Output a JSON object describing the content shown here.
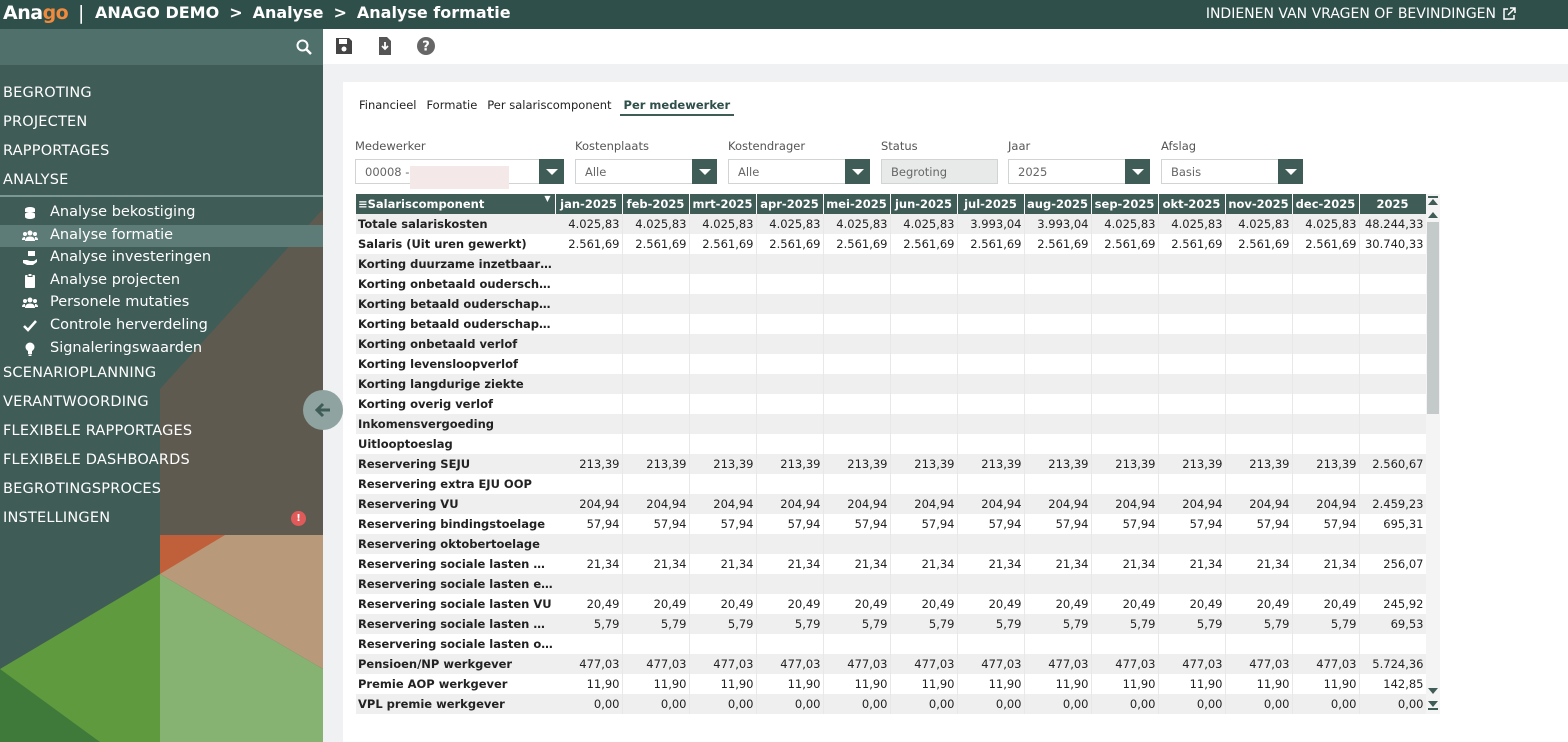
{
  "topbar": {
    "logo_a": "Ana",
    "logo_b": "go",
    "logo_sep": "|",
    "crumbs": [
      "ANAGO DEMO",
      ">",
      "Analyse",
      ">",
      "Analyse formatie"
    ],
    "report_link": "INDIENEN VAN VRAGEN OF BEVINDINGEN"
  },
  "sidebar": {
    "search_icon": "search-icon",
    "main_items_top": [
      "BEGROTING",
      "PROJECTEN",
      "RAPPORTAGES",
      "ANALYSE"
    ],
    "sub_items": [
      {
        "label": "Analyse bekostiging",
        "icon": "coins-icon"
      },
      {
        "label": "Analyse formatie",
        "icon": "users-icon",
        "active": true
      },
      {
        "label": "Analyse investeringen",
        "icon": "hand-money-icon"
      },
      {
        "label": "Analyse projecten",
        "icon": "clipboard-icon"
      },
      {
        "label": "Personele mutaties",
        "icon": "users-icon"
      },
      {
        "label": "Controle herverdeling",
        "icon": "check-icon"
      },
      {
        "label": "Signaleringswaarden",
        "icon": "lightbulb-icon"
      }
    ],
    "main_items_bottom": [
      "SCENARIOPLANNING",
      "VERANTWOORDING",
      "FLEXIBELE RAPPORTAGES",
      "FLEXIBELE DASHBOARDS",
      "BEGROTINGSPROCES",
      "INSTELLINGEN"
    ],
    "warning_badge": "!"
  },
  "toolbar": {
    "icons": [
      "save-icon",
      "export-icon",
      "help-icon"
    ]
  },
  "tabs": [
    "Financieel",
    "Formatie",
    "Per salariscomponent",
    "Per medewerker"
  ],
  "active_tab": 3,
  "filters": {
    "medewerker": {
      "label": "Medewerker",
      "value": "00008 -"
    },
    "kostenplaats": {
      "label": "Kostenplaats",
      "value": "Alle"
    },
    "kostendrager": {
      "label": "Kostendrager",
      "value": "Alle"
    },
    "status": {
      "label": "Status",
      "value": "Begroting"
    },
    "jaar": {
      "label": "Jaar",
      "value": "2025"
    },
    "afslag": {
      "label": "Afslag",
      "value": "Basis"
    }
  },
  "grid": {
    "columns": [
      "Salariscomponent",
      "jan-2025",
      "feb-2025",
      "mrt-2025",
      "apr-2025",
      "mei-2025",
      "jun-2025",
      "jul-2025",
      "aug-2025",
      "sep-2025",
      "okt-2025",
      "nov-2025",
      "dec-2025",
      "2025"
    ],
    "rows": [
      [
        "Totale salariskosten",
        "4.025,83",
        "4.025,83",
        "4.025,83",
        "4.025,83",
        "4.025,83",
        "4.025,83",
        "3.993,04",
        "3.993,04",
        "4.025,83",
        "4.025,83",
        "4.025,83",
        "4.025,83",
        "48.244,33"
      ],
      [
        "Salaris (Uit uren gewerkt)",
        "2.561,69",
        "2.561,69",
        "2.561,69",
        "2.561,69",
        "2.561,69",
        "2.561,69",
        "2.561,69",
        "2.561,69",
        "2.561,69",
        "2.561,69",
        "2.561,69",
        "2.561,69",
        "30.740,33"
      ],
      [
        "Korting duurzame inzetbaarheid",
        "",
        "",
        "",
        "",
        "",
        "",
        "",
        "",
        "",
        "",
        "",
        "",
        ""
      ],
      [
        "Korting onbetaald ouderschapsv...",
        "",
        "",
        "",
        "",
        "",
        "",
        "",
        "",
        "",
        "",
        "",
        "",
        ""
      ],
      [
        "Korting betaald ouderschapsverlof",
        "",
        "",
        "",
        "",
        "",
        "",
        "",
        "",
        "",
        "",
        "",
        "",
        ""
      ],
      [
        "Korting betaald ouderschapsverl...",
        "",
        "",
        "",
        "",
        "",
        "",
        "",
        "",
        "",
        "",
        "",
        "",
        ""
      ],
      [
        "Korting onbetaald verlof",
        "",
        "",
        "",
        "",
        "",
        "",
        "",
        "",
        "",
        "",
        "",
        "",
        ""
      ],
      [
        "Korting levensloopverlof",
        "",
        "",
        "",
        "",
        "",
        "",
        "",
        "",
        "",
        "",
        "",
        "",
        ""
      ],
      [
        "Korting langdurige ziekte",
        "",
        "",
        "",
        "",
        "",
        "",
        "",
        "",
        "",
        "",
        "",
        "",
        ""
      ],
      [
        "Korting overig verlof",
        "",
        "",
        "",
        "",
        "",
        "",
        "",
        "",
        "",
        "",
        "",
        "",
        ""
      ],
      [
        "Inkomensvergoeding",
        "",
        "",
        "",
        "",
        "",
        "",
        "",
        "",
        "",
        "",
        "",
        "",
        ""
      ],
      [
        "Uitlooptoeslag",
        "",
        "",
        "",
        "",
        "",
        "",
        "",
        "",
        "",
        "",
        "",
        "",
        ""
      ],
      [
        "Reservering SEJU",
        "213,39",
        "213,39",
        "213,39",
        "213,39",
        "213,39",
        "213,39",
        "213,39",
        "213,39",
        "213,39",
        "213,39",
        "213,39",
        "213,39",
        "2.560,67"
      ],
      [
        "Reservering extra EJU OOP",
        "",
        "",
        "",
        "",
        "",
        "",
        "",
        "",
        "",
        "",
        "",
        "",
        ""
      ],
      [
        "Reservering VU",
        "204,94",
        "204,94",
        "204,94",
        "204,94",
        "204,94",
        "204,94",
        "204,94",
        "204,94",
        "204,94",
        "204,94",
        "204,94",
        "204,94",
        "2.459,23"
      ],
      [
        "Reservering bindingstoelage",
        "57,94",
        "57,94",
        "57,94",
        "57,94",
        "57,94",
        "57,94",
        "57,94",
        "57,94",
        "57,94",
        "57,94",
        "57,94",
        "57,94",
        "695,31"
      ],
      [
        "Reservering oktobertoelage",
        "",
        "",
        "",
        "",
        "",
        "",
        "",
        "",
        "",
        "",
        "",
        "",
        ""
      ],
      [
        "Reservering sociale lasten SEJU",
        "21,34",
        "21,34",
        "21,34",
        "21,34",
        "21,34",
        "21,34",
        "21,34",
        "21,34",
        "21,34",
        "21,34",
        "21,34",
        "21,34",
        "256,07"
      ],
      [
        "Reservering sociale lasten extra ...",
        "",
        "",
        "",
        "",
        "",
        "",
        "",
        "",
        "",
        "",
        "",
        "",
        ""
      ],
      [
        "Reservering sociale lasten VU",
        "20,49",
        "20,49",
        "20,49",
        "20,49",
        "20,49",
        "20,49",
        "20,49",
        "20,49",
        "20,49",
        "20,49",
        "20,49",
        "20,49",
        "245,92"
      ],
      [
        "Reservering sociale lasten bindin...",
        "5,79",
        "5,79",
        "5,79",
        "5,79",
        "5,79",
        "5,79",
        "5,79",
        "5,79",
        "5,79",
        "5,79",
        "5,79",
        "5,79",
        "69,53"
      ],
      [
        "Reservering sociale lasten oktob...",
        "",
        "",
        "",
        "",
        "",
        "",
        "",
        "",
        "",
        "",
        "",
        "",
        ""
      ],
      [
        "Pensioen/NP werkgever",
        "477,03",
        "477,03",
        "477,03",
        "477,03",
        "477,03",
        "477,03",
        "477,03",
        "477,03",
        "477,03",
        "477,03",
        "477,03",
        "477,03",
        "5.724,36"
      ],
      [
        "Premie AOP werkgever",
        "11,90",
        "11,90",
        "11,90",
        "11,90",
        "11,90",
        "11,90",
        "11,90",
        "11,90",
        "11,90",
        "11,90",
        "11,90",
        "11,90",
        "142,85"
      ],
      [
        "VPL premie werkgever",
        "0,00",
        "0,00",
        "0,00",
        "0,00",
        "0,00",
        "0,00",
        "0,00",
        "0,00",
        "0,00",
        "0,00",
        "0,00",
        "0,00",
        "0,00"
      ]
    ]
  }
}
